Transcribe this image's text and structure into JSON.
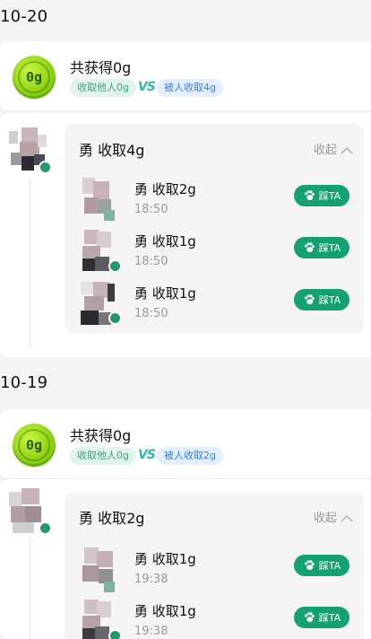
{
  "colors": {
    "accent_green": "#14a172",
    "pill_green_text": "#3e9f7c",
    "pill_blue_text": "#3f7fd8",
    "muted": "#9a9a9a"
  },
  "days": [
    {
      "date": "10-20",
      "coin_text": "0g",
      "total_text": "共获得0g",
      "collected_others": "收取他人0g",
      "vs": "VS",
      "collected_by_others": "被人收取4g",
      "group": {
        "title": "勇 收取4g",
        "collapse_label": "收起",
        "records": [
          {
            "title": "勇 收取2g",
            "time": "18:50",
            "button": "踩TA"
          },
          {
            "title": "勇 收取1g",
            "time": "18:50",
            "button": "踩TA"
          },
          {
            "title": "勇 收取1g",
            "time": "18:50",
            "button": "踩TA"
          }
        ]
      }
    },
    {
      "date": "10-19",
      "coin_text": "0g",
      "total_text": "共获得0g",
      "collected_others": "收取他人0g",
      "vs": "VS",
      "collected_by_others": "被人收取2g",
      "group": {
        "title": "勇 收取2g",
        "collapse_label": "收起",
        "records": [
          {
            "title": "勇 收取1g",
            "time": "19:38",
            "button": "踩TA"
          },
          {
            "title": "勇 收取1g",
            "time": "19:38",
            "button": "踩TA"
          }
        ]
      }
    }
  ]
}
